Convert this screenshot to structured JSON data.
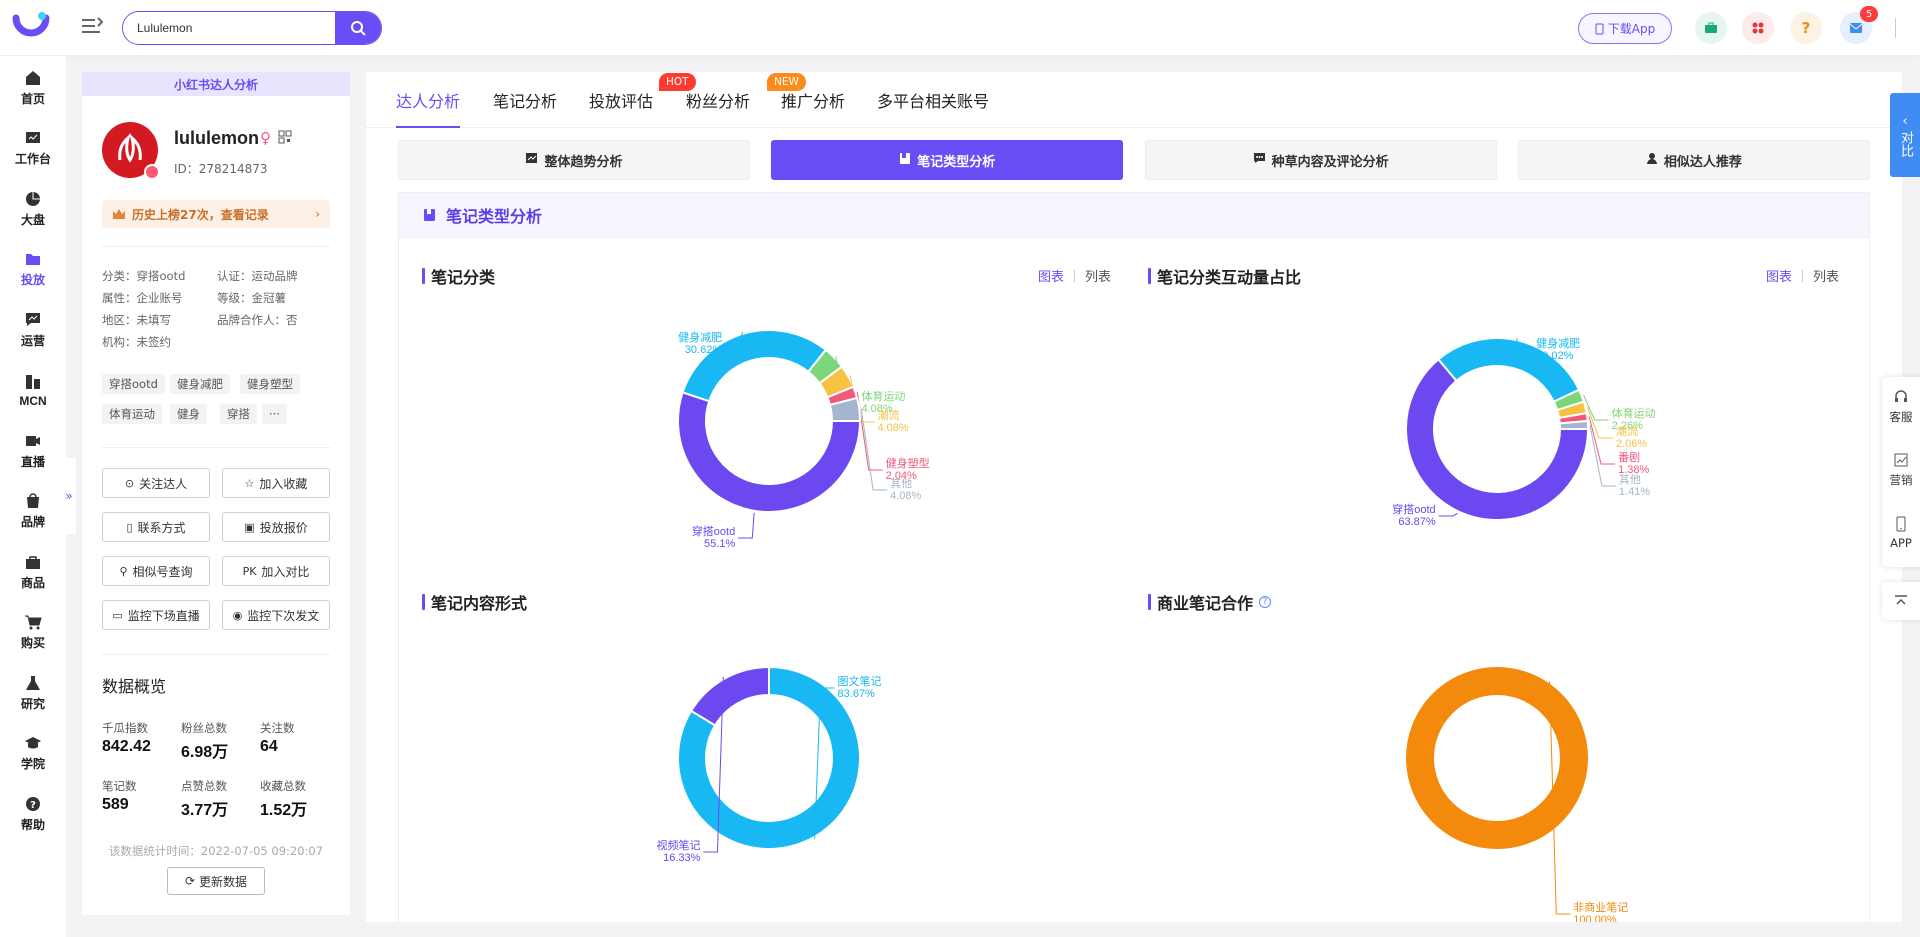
{
  "search": {
    "value": "Lululemon"
  },
  "header": {
    "download_app": "下载App",
    "notification_count": "5"
  },
  "nav": [
    {
      "label": "首页",
      "icon": "home-icon"
    },
    {
      "label": "工作台",
      "icon": "workbench-icon"
    },
    {
      "label": "大盘",
      "icon": "pie-chart-icon"
    },
    {
      "label": "投放",
      "icon": "folder-icon"
    },
    {
      "label": "运营",
      "icon": "chat-chart-icon"
    },
    {
      "label": "MCN",
      "icon": "mcn-icon"
    },
    {
      "label": "直播",
      "icon": "video-icon"
    },
    {
      "label": "品牌",
      "icon": "brand-icon"
    },
    {
      "label": "商品",
      "icon": "bag-icon"
    },
    {
      "label": "购买",
      "icon": "cart-icon"
    },
    {
      "label": "研究",
      "icon": "flask-icon"
    },
    {
      "label": "学院",
      "icon": "graduation-icon"
    },
    {
      "label": "帮助",
      "icon": "help-icon"
    }
  ],
  "profile": {
    "header": "小红书达人分析",
    "name": "lululemon",
    "id": "ID：278214873",
    "history": "历史上榜27次，查看记录",
    "attrs": [
      {
        "k": "分类：",
        "v": "穿搭ootd"
      },
      {
        "k": "认证：",
        "v": "运动品牌"
      },
      {
        "k": "属性：",
        "v": "企业账号"
      },
      {
        "k": "等级：",
        "v": "金冠薯"
      },
      {
        "k": "地区：",
        "v": "未填写"
      },
      {
        "k": "品牌合作人：",
        "v": "否"
      },
      {
        "k": "机构：",
        "v": "未签约"
      }
    ],
    "tags": [
      "穿搭ootd",
      "健身减肥",
      "健身塑型",
      "体育运动",
      "健身",
      "穿搭",
      "···"
    ],
    "actions": [
      "关注达人",
      "加入收藏",
      "联系方式",
      "投放报价",
      "相似号查询",
      "加入对比",
      "监控下场直播",
      "监控下次发文"
    ],
    "overview_title": "数据概览",
    "overview": [
      {
        "label": "千瓜指数",
        "value": "842.42"
      },
      {
        "label": "粉丝总数",
        "value": "6.98万"
      },
      {
        "label": "关注数",
        "value": "64"
      },
      {
        "label": "笔记数",
        "value": "589"
      },
      {
        "label": "点赞总数",
        "value": "3.77万"
      },
      {
        "label": "收藏总数",
        "value": "1.52万"
      }
    ],
    "stat_time": "该数据统计时间：2022-07-05 09:20:07",
    "refresh": "更新数据"
  },
  "tabs": [
    {
      "label": "达人分析",
      "active": true
    },
    {
      "label": "笔记分析"
    },
    {
      "label": "投放评估",
      "badge": "HOT"
    },
    {
      "label": "粉丝分析"
    },
    {
      "label": "推广分析",
      "badge": "NEW"
    },
    {
      "label": "多平台相关账号"
    }
  ],
  "subtabs": [
    {
      "label": "整体趋势分析",
      "icon": "trend-icon"
    },
    {
      "label": "笔记类型分析",
      "icon": "book-icon",
      "active": true
    },
    {
      "label": "种草内容及评论分析",
      "icon": "comment-icon"
    },
    {
      "label": "相似达人推荐",
      "icon": "user-icon"
    }
  ],
  "section_title": "笔记类型分析",
  "view_toggle": {
    "chart": "图表",
    "list": "列表"
  },
  "right_tools": {
    "compare": "对比",
    "service": "客服",
    "marketing": "营销",
    "app": "APP"
  },
  "chart_data": [
    {
      "type": "pie",
      "title": "笔记分类",
      "donut": true,
      "categories": [
        "穿搭ootd",
        "健身减肥",
        "体育运动",
        "潮流",
        "健身塑型",
        "其他"
      ],
      "values": [
        55.1,
        30.62,
        4.08,
        4.08,
        2.04,
        4.08
      ],
      "labels": [
        "55.1%",
        "30.62%",
        "4.08%",
        "4.08%",
        "2.04%",
        "4.08%"
      ],
      "colors": [
        "#6b48f0",
        "#17b8f4",
        "#7cd67a",
        "#f7c144",
        "#f2587a",
        "#a2b6cc"
      ]
    },
    {
      "type": "pie",
      "title": "笔记分类互动量占比",
      "donut": true,
      "categories": [
        "穿搭ootd",
        "健身减肥",
        "体育运动",
        "潮流",
        "番剧",
        "其他"
      ],
      "values": [
        63.87,
        29.02,
        2.26,
        2.06,
        1.38,
        1.41
      ],
      "labels": [
        "63.87%",
        "29.02%",
        "2.26%",
        "2.06%",
        "1.38%",
        "1.41%"
      ],
      "colors": [
        "#6b48f0",
        "#17b8f4",
        "#7cd67a",
        "#f7c144",
        "#f2587a",
        "#a2b6cc"
      ]
    },
    {
      "type": "pie",
      "title": "笔记内容形式",
      "donut": true,
      "categories": [
        "图文笔记",
        "视频笔记"
      ],
      "values": [
        83.67,
        16.33
      ],
      "labels": [
        "83.67%",
        "16.33%"
      ],
      "colors": [
        "#17b8f4",
        "#6b48f0"
      ]
    },
    {
      "type": "pie",
      "title": "商业笔记合作",
      "donut": true,
      "categories": [
        "非商业笔记"
      ],
      "values": [
        100.0
      ],
      "labels": [
        "100.00%"
      ],
      "colors": [
        "#f48a0c"
      ]
    }
  ]
}
